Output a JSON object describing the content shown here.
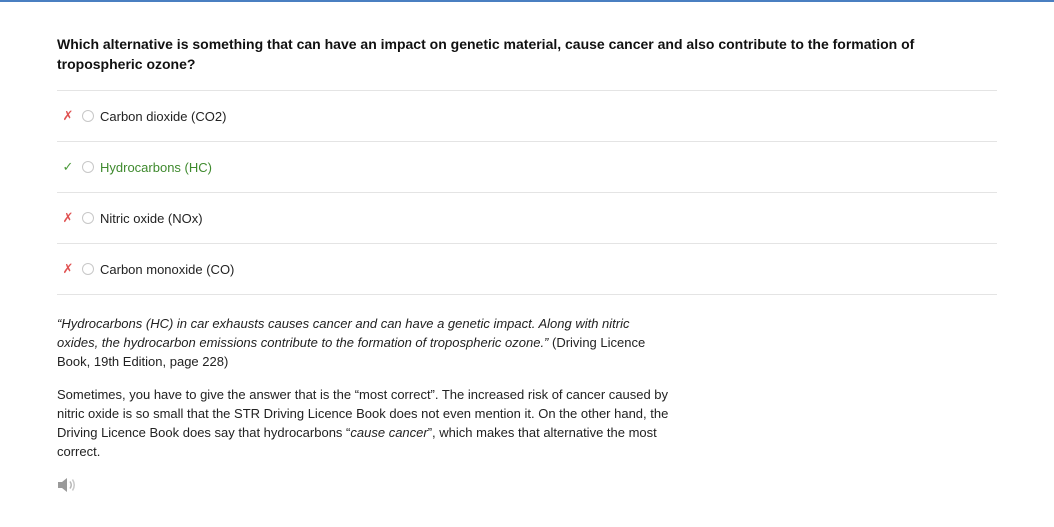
{
  "question": "Which alternative is something that can have an impact on genetic material, cause cancer and also contribute to the formation of tropospheric ozone?",
  "options": [
    {
      "mark": "✗",
      "label": "Carbon dioxide (CO2)",
      "correct": false
    },
    {
      "mark": "✓",
      "label": "Hydrocarbons (HC)",
      "correct": true
    },
    {
      "mark": "✗",
      "label": "Nitric oxide (NOx)",
      "correct": false
    },
    {
      "mark": "✗",
      "label": "Carbon monoxide (CO)",
      "correct": false
    }
  ],
  "explanation": {
    "quote_italic": "“Hydrocarbons (HC) in car exhausts causes cancer and can have a genetic impact. Along with nitric oxides, the hydrocarbon emissions contribute to the formation of tropospheric ozone.”",
    "quote_source": " (Driving Licence Book, 19th Edition, page 228)",
    "para_before": "Sometimes, you have to give the answer that is the “most correct”. The increased risk of cancer caused by nitric oxide is so small that the STR Driving Licence Book does not even mention it. On the other hand, the Driving Licence Book does say that hydrocarbons “",
    "para_italic": "cause cancer",
    "para_after": "”, which makes that alternative the most correct."
  },
  "colors": {
    "wrong": "#e05252",
    "right": "#4b9a3a",
    "accent": "#4a7fc1"
  },
  "audio": {
    "icon": "speaker-icon"
  }
}
